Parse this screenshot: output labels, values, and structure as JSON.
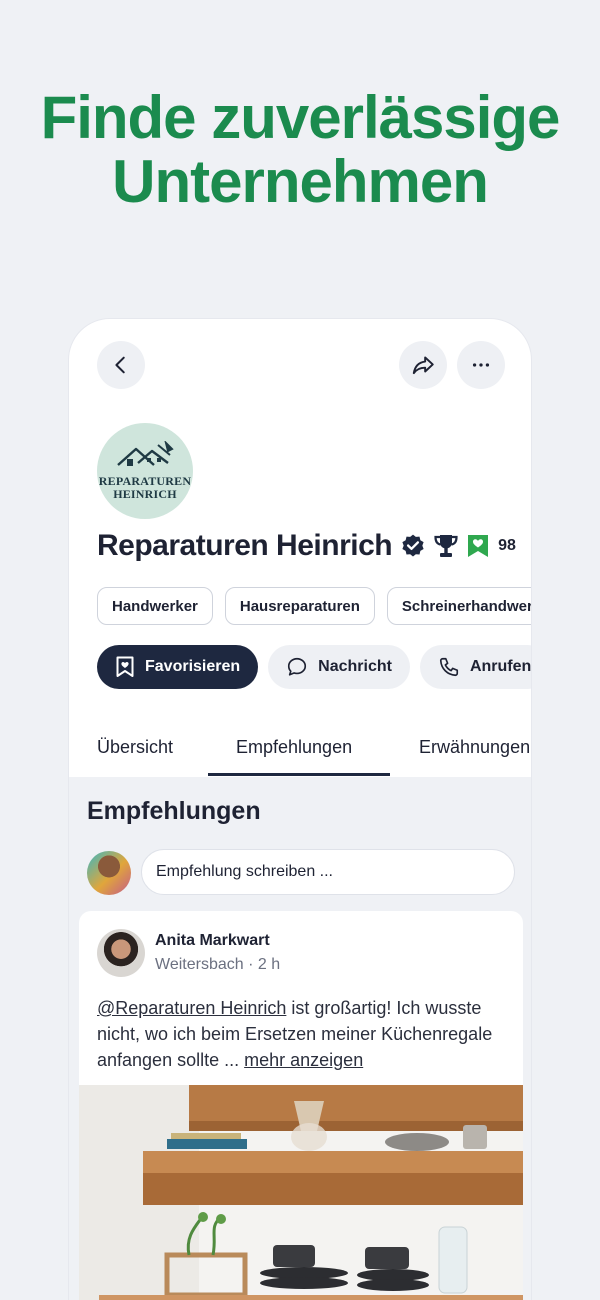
{
  "headline": {
    "line1": "Finde zuverlässige",
    "line2": "Unternehmen"
  },
  "business": {
    "logo_line1": "REPARATUREN",
    "logo_line2": "HEINRICH",
    "name": "Reparaturen Heinrich",
    "score": "98",
    "icons": [
      "verified-badge-icon",
      "trophy-icon",
      "favorite-bookmark-icon"
    ]
  },
  "categories": [
    "Handwerker",
    "Hausreparaturen",
    "Schreinerhandwerk"
  ],
  "actions": {
    "favorite": "Favorisieren",
    "message": "Nachricht",
    "call": "Anrufen"
  },
  "tabs": [
    "Übersicht",
    "Empfehlungen",
    "Erwähnungen"
  ],
  "recommendations": {
    "title": "Empfehlungen",
    "input_placeholder": "Empfehlung schreiben ..."
  },
  "post": {
    "author": "Anita Markwart",
    "meta": "Weitersbach · 2 h",
    "mention": "@Reparaturen Heinrich",
    "text": " ist großartig! Ich wusste nicht, wo ich beim Ersetzen meiner Küchenregale anfangen sollte",
    "ellipsis": " ... ",
    "more": "mehr anzeigen"
  },
  "colors": {
    "brand_green": "#1b8b4e",
    "primary_dark": "#1e2840",
    "badge_green": "#2fa84f"
  }
}
